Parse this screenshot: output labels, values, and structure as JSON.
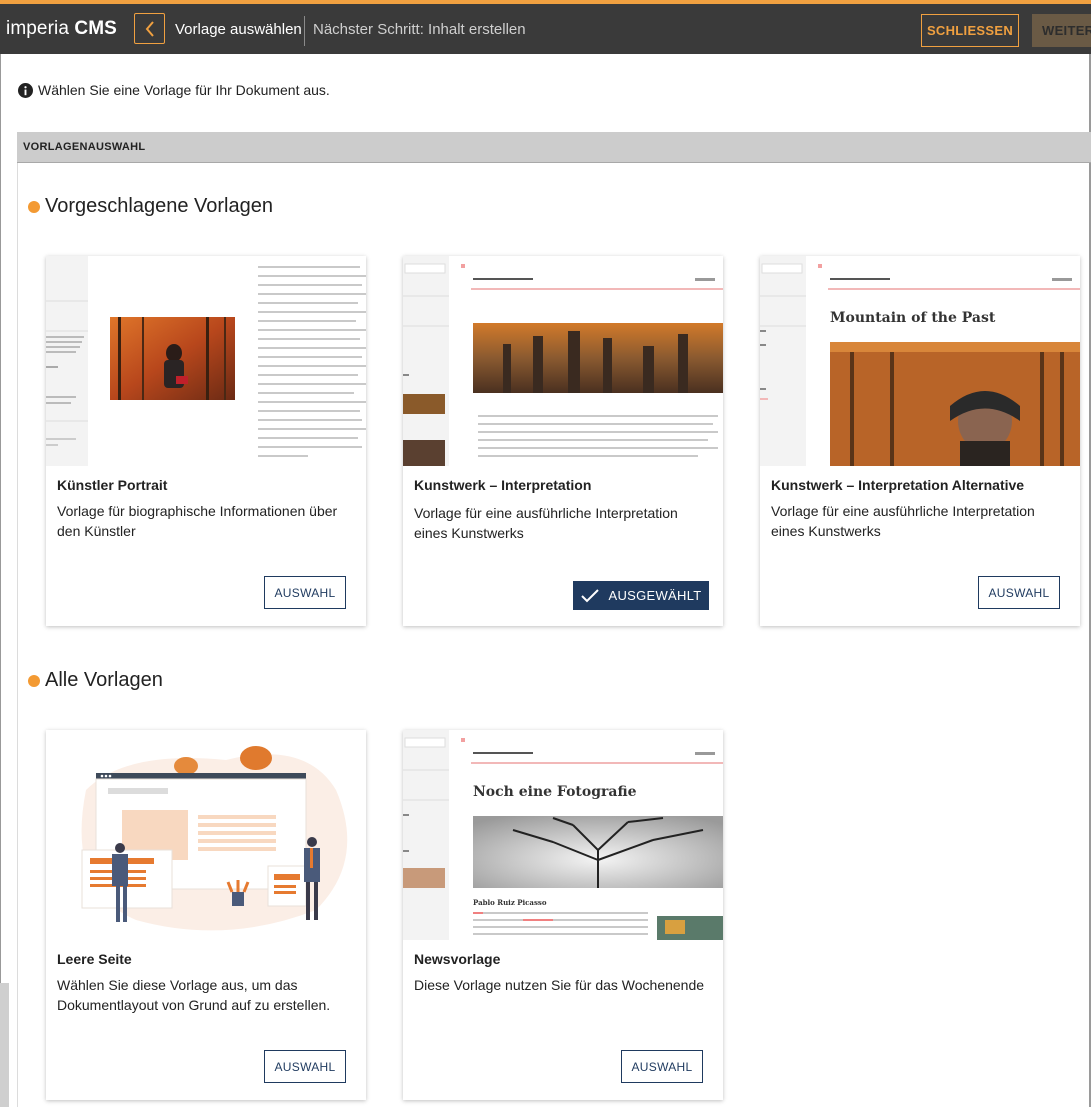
{
  "app": {
    "logo_light": "imperia",
    "logo_bold": "CMS",
    "current_step": "Vorlage auswählen",
    "next_step": "Nächster Schritt: Inhalt erstellen",
    "close_label": "SCHLIESSEN",
    "next_label": "WEITER"
  },
  "info": {
    "text": "Wählen Sie eine Vorlage für Ihr Dokument aus."
  },
  "section": {
    "title": "VORLAGENAUSWAHL"
  },
  "suggested": {
    "title": "Vorgeschlagene Vorlagen",
    "cards": [
      {
        "title": "Künstler Portrait",
        "description": "Vorlage für biographische Informationen über den Künstler",
        "button": "AUSWAHL"
      },
      {
        "title": "Kunstwerk – Interpretation",
        "description": "Vorlage für eine ausführliche Interpretation eines Kunstwerks",
        "button": "AUSGEWÄHLT"
      },
      {
        "title": "Kunstwerk – Interpretation  Alternative",
        "description": "Vorlage für eine ausführliche Interpretation eines Kunstwerks",
        "button": "AUSWAHL"
      }
    ]
  },
  "all": {
    "title": "Alle Vorlagen",
    "cards": [
      {
        "title": "Leere Seite",
        "description": "Wählen Sie diese Vorlage aus, um das Dokumentlayout von Grund auf zu erstellen.",
        "button": "AUSWAHL"
      },
      {
        "title": "Newsvorlage",
        "description": "Diese Vorlage nutzen Sie für das Wochenende",
        "button": "AUSWAHL"
      }
    ]
  },
  "thumbs": {
    "interpretation_alt_heading": "Mountain of the Past",
    "news_heading": "Noch eine Fotografie",
    "news_author": "Pablo Ruiz Picasso"
  },
  "colors": {
    "accent": "#f39a33",
    "topbar": "#3a3a3a",
    "primary": "#1f3a5f"
  }
}
